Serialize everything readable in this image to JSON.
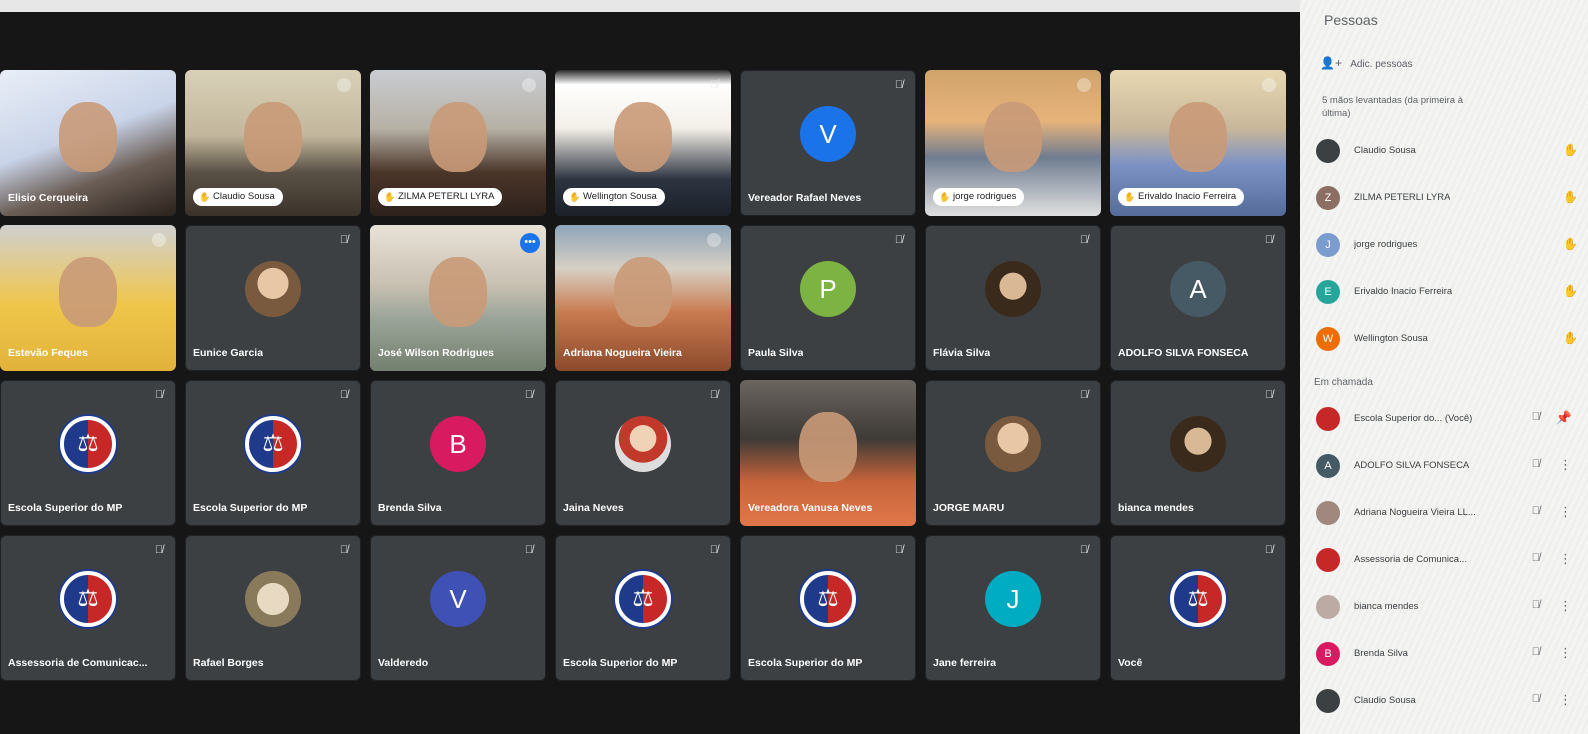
{
  "tiles": [
    {
      "name": "Elisio Cerqueira",
      "style": "pill-less",
      "video": "v1",
      "mic": "none"
    },
    {
      "name": "Claudio Sousa",
      "style": "pill",
      "video": "v2",
      "mic": "round"
    },
    {
      "name": "ZILMA PETERLI LYRA",
      "style": "pill",
      "video": "v3",
      "mic": "round"
    },
    {
      "name": "Wellington Sousa",
      "style": "pill",
      "video": "v4",
      "mic": "muted"
    },
    {
      "name": "Vereador Rafael Neves",
      "initial": "V",
      "color": "#1a73e8",
      "mic": "muted"
    },
    {
      "name": "jorge rodrigues",
      "style": "pill",
      "video": "v5",
      "mic": "round"
    },
    {
      "name": "Erivaldo Inacio Ferreira",
      "style": "pill",
      "video": "v6",
      "mic": "round"
    },
    {
      "name": "Estevão Feques",
      "style": "pill-less",
      "video": "v7",
      "mic": "round"
    },
    {
      "name": "Eunice Garcia",
      "avatar": "photo",
      "mic": "muted"
    },
    {
      "name": "José Wilson Rodrigues",
      "style": "pill-less",
      "video": "v8",
      "mic": "more",
      "active": true
    },
    {
      "name": "Adriana Nogueira Vieira",
      "style": "pill-less",
      "video": "v9",
      "mic": "round"
    },
    {
      "name": "Paula Silva",
      "initial": "P",
      "color": "#7cb342",
      "mic": "muted"
    },
    {
      "name": "Flávia Silva",
      "avatar": "photo2",
      "mic": "muted"
    },
    {
      "name": "ADOLFO SILVA FONSECA",
      "initial": "A",
      "color": "#455a64",
      "mic": "muted"
    },
    {
      "name": "Escola Superior do MP",
      "avatar": "logo",
      "mic": "muted"
    },
    {
      "name": "Escola Superior do MP",
      "avatar": "logo",
      "mic": "muted"
    },
    {
      "name": "Brenda Silva",
      "initial": "B",
      "color": "#d81b60",
      "mic": "muted"
    },
    {
      "name": "Jaina Neves",
      "avatar": "photo3",
      "mic": "muted"
    },
    {
      "name": "Vereadora Vanusa Neves",
      "style": "pill-less",
      "video": "v10",
      "mic": "none"
    },
    {
      "name": "JORGE MARU",
      "avatar": "photo",
      "mic": "muted"
    },
    {
      "name": "bianca mendes",
      "avatar": "photo2",
      "mic": "muted"
    },
    {
      "name": "Assessoria de Comunicac...",
      "avatar": "logo",
      "mic": "muted"
    },
    {
      "name": "Rafael Borges",
      "avatar": "photo4",
      "mic": "muted"
    },
    {
      "name": "Valderedo",
      "initial": "V",
      "color": "#3f51b5",
      "mic": "muted"
    },
    {
      "name": "Escola Superior do MP",
      "avatar": "logo",
      "mic": "muted"
    },
    {
      "name": "Escola Superior do MP",
      "avatar": "logo",
      "mic": "muted"
    },
    {
      "name": "Jane ferreira",
      "initial": "J",
      "color": "#00acc1",
      "mic": "muted"
    },
    {
      "name": "Você",
      "avatar": "logo",
      "mic": "muted"
    }
  ],
  "panel": {
    "title": "Pessoas",
    "add_people": "Adic. pessoas",
    "raised_hands_heading": "5 mãos levantadas (da primeira à última)",
    "raised": [
      {
        "name": "Claudio Sousa",
        "initial": "",
        "color": "#3c4043"
      },
      {
        "name": "ZILMA PETERLI LYRA",
        "initial": "Z",
        "color": "#8d6e63"
      },
      {
        "name": "jorge rodrigues",
        "initial": "J",
        "color": "#7b9ccf"
      },
      {
        "name": "Erivaldo Inacio Ferreira",
        "initial": "E",
        "color": "#26a69a"
      },
      {
        "name": "Wellington Sousa",
        "initial": "W",
        "color": "#ef6c00"
      }
    ],
    "in_call_heading": "Em chamada",
    "in_call": [
      {
        "name": "Escola Superior do... (Você)",
        "initial": "",
        "color": "#c62828"
      },
      {
        "name": "ADOLFO SILVA FONSECA",
        "initial": "A",
        "color": "#455a64"
      },
      {
        "name": "Adriana Nogueira Vieira LL...",
        "initial": "",
        "color": "#a1887f"
      },
      {
        "name": "Assessoria de Comunica...",
        "initial": "",
        "color": "#c62828"
      },
      {
        "name": "bianca mendes",
        "initial": "",
        "color": "#bcaaa4"
      },
      {
        "name": "Brenda Silva",
        "initial": "B",
        "color": "#d81b60"
      },
      {
        "name": "Claudio Sousa",
        "initial": "",
        "color": "#3c4043"
      }
    ]
  }
}
